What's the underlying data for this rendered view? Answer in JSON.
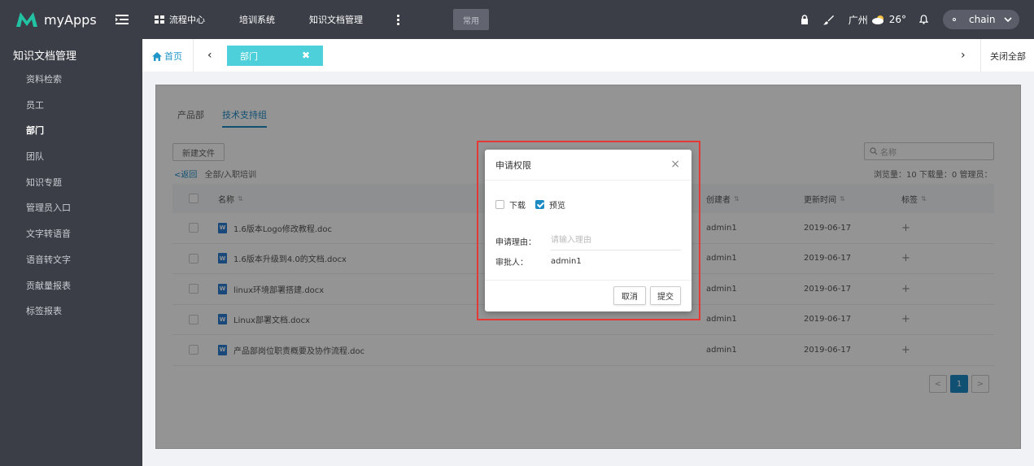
{
  "app": {
    "name": "myApps"
  },
  "nav": {
    "items": [
      "流程中心",
      "培训系统",
      "知识文档管理"
    ],
    "common": "常用"
  },
  "tools": {
    "city": "广州",
    "temp": "26°",
    "user": "chain"
  },
  "sidebar": {
    "title": "知识文档管理",
    "items": [
      "资料检索",
      "员工",
      "部门",
      "团队",
      "知识专题",
      "管理员入口",
      "文字转语音",
      "语音转文字",
      "贡献量报表",
      "标签报表"
    ],
    "active": "部门"
  },
  "tabbar": {
    "home": "首页",
    "active_tab": "部门",
    "close_all": "关闭全部"
  },
  "content": {
    "subtabs": [
      "产品部",
      "技术支持组"
    ],
    "new_file": "新建文件",
    "search_placeholder": "名称",
    "back": "<返回",
    "path": "全部/入职培训",
    "stats": "浏览量：10   下载量：0   管理员：",
    "columns": {
      "name": "名称",
      "creator": "创建者",
      "time": "更新时间",
      "tag": "标签"
    },
    "rows": [
      {
        "name": "1.6版本Logo修改教程.doc",
        "creator": "admin1",
        "time": "2019-06-17",
        "tag": "+"
      },
      {
        "name": "1.6版本升级到4.0的文档.docx",
        "creator": "admin1",
        "time": "2019-06-17",
        "tag": "+"
      },
      {
        "name": "linux环境部署搭建.docx",
        "creator": "admin1",
        "time": "2019-06-17",
        "tag": "+"
      },
      {
        "name": "Linux部署文档.docx",
        "creator": "admin1",
        "time": "2019-06-17",
        "tag": "+"
      },
      {
        "name": "产品部岗位职责概要及协作流程.doc",
        "creator": "admin1",
        "time": "2019-06-17",
        "tag": "+"
      }
    ],
    "pager": {
      "prev": "<",
      "current": "1",
      "next": ">"
    }
  },
  "dialog": {
    "title": "申请权限",
    "close": "×",
    "option_download": "下载",
    "option_preview": "预览",
    "reason_label": "申请理由：",
    "reason_placeholder": "请输入理由",
    "approver_label": "审批人：",
    "approver": "admin1",
    "cancel": "取消",
    "submit": "提交"
  }
}
